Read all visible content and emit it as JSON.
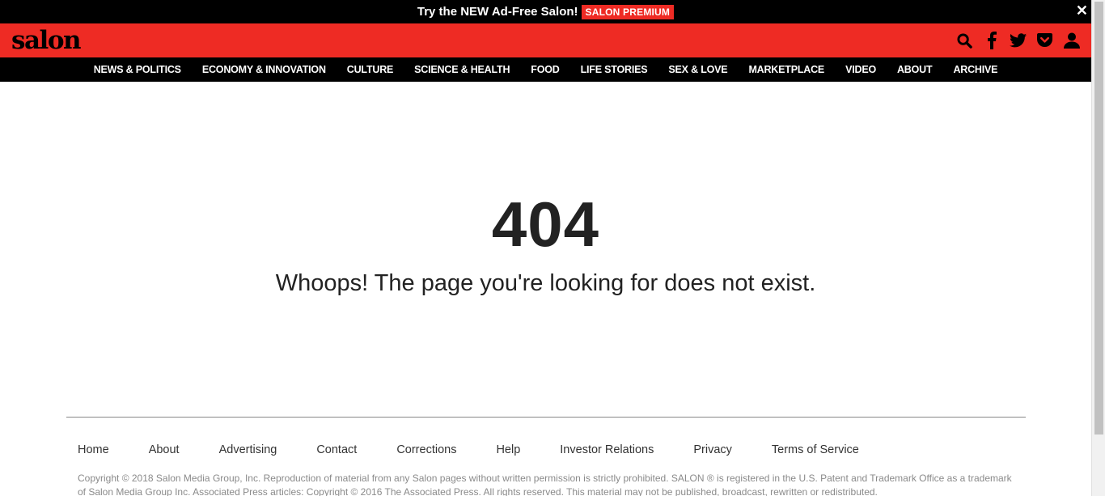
{
  "promo": {
    "text": "Try the NEW Ad-Free Salon!",
    "badge": "SALON PREMIUM",
    "close": "✕"
  },
  "header": {
    "logo": "salon",
    "icons": [
      "search-icon",
      "facebook-icon",
      "twitter-icon",
      "pocket-icon",
      "user-icon"
    ]
  },
  "nav": {
    "items": [
      {
        "label": "NEWS & POLITICS"
      },
      {
        "label": "ECONOMY & INNOVATION"
      },
      {
        "label": "CULTURE"
      },
      {
        "label": "SCIENCE & HEALTH"
      },
      {
        "label": "FOOD"
      },
      {
        "label": "LIFE STORIES"
      },
      {
        "label": "SEX & LOVE"
      },
      {
        "label": "MARKETPLACE"
      },
      {
        "label": "VIDEO"
      },
      {
        "label": "ABOUT"
      },
      {
        "label": "ARCHIVE"
      }
    ]
  },
  "error": {
    "code": "404",
    "message": "Whoops! The page you're looking for does not exist."
  },
  "footer": {
    "links": [
      {
        "label": "Home"
      },
      {
        "label": "About"
      },
      {
        "label": "Advertising"
      },
      {
        "label": "Contact"
      },
      {
        "label": "Corrections"
      },
      {
        "label": "Help"
      },
      {
        "label": "Investor Relations"
      },
      {
        "label": "Privacy"
      },
      {
        "label": "Terms of Service"
      }
    ],
    "copyright": "Copyright © 2018 Salon Media Group, Inc. Reproduction of material from any Salon pages without written permission is strictly prohibited. SALON ® is registered in the U.S. Patent and Trademark Office as a trademark of Salon Media Group Inc. Associated Press articles: Copyright © 2016 The Associated Press. All rights reserved. This material may not be published, broadcast, rewritten or redistributed."
  },
  "colors": {
    "brand_red": "#ee2b24",
    "black": "#000000"
  }
}
